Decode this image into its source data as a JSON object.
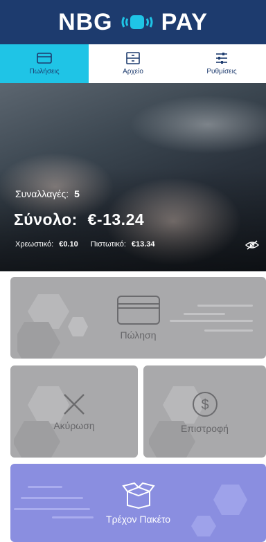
{
  "app": {
    "brand_left": "NBG",
    "brand_right": "PAY",
    "logo_icon": "chip-wave-icon"
  },
  "tabs": [
    {
      "label": "Πωλήσεις",
      "icon": "card-icon",
      "active": true
    },
    {
      "label": "Αρχείο",
      "icon": "archive-icon",
      "active": false
    },
    {
      "label": "Ρυθμίσεις",
      "icon": "sliders-icon",
      "active": false
    }
  ],
  "summary": {
    "transactions_label": "Συναλλαγές:",
    "transactions_count": "5",
    "total_label": "Σύνολο:",
    "total_value": "€-13.24",
    "debit_label": "Χρεωστικό:",
    "debit_value": "€0.10",
    "credit_label": "Πιστωτικό:",
    "credit_value": "€13.34",
    "visibility_icon": "eye-off-icon"
  },
  "actions": {
    "sale": "Πώληση",
    "cancel": "Ακύρωση",
    "refund": "Επιστροφή",
    "package": "Τρέχον Πακέτο"
  },
  "colors": {
    "header": "#1d3b6e",
    "active_tab": "#1fc4e6",
    "tile": "#a9a9ab",
    "package_tile": "#8a8ee0"
  }
}
